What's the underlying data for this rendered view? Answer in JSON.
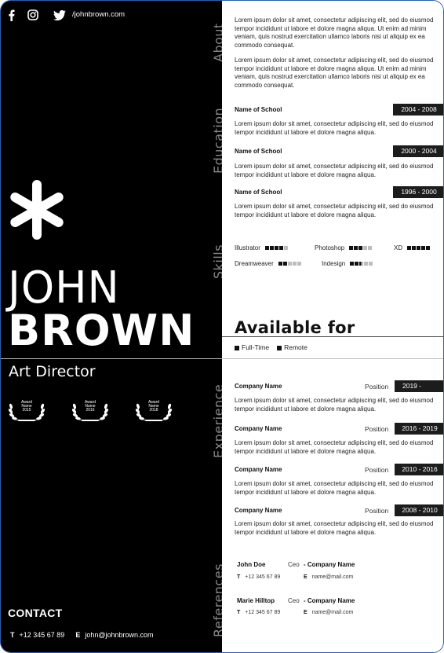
{
  "header": {
    "social_url": "/johnbrown.com",
    "icons": [
      "facebook-icon",
      "instagram-icon",
      "twitter-icon"
    ]
  },
  "profile": {
    "first_name": "JOHN",
    "last_name": "BROWN",
    "title": "Art Director",
    "awards": [
      {
        "line1": "Award",
        "line2": "Name",
        "line3": "2015"
      },
      {
        "line1": "Award",
        "line2": "Name",
        "line3": "2016"
      },
      {
        "line1": "Award",
        "line2": "Name",
        "line3": "2018"
      }
    ]
  },
  "contact": {
    "title": "CONTACT",
    "phone_label": "T",
    "phone": "+12 345 67 89",
    "email_label": "E",
    "email": "john@johnbrown.com"
  },
  "sections": {
    "about": "About",
    "education": "Education",
    "skills": "Skills",
    "experience": "Experience",
    "references": "References"
  },
  "about": {
    "paragraphs": [
      "Lorem ipsum dolor sit amet, consectetur adipiscing elit, sed do eiusmod tempor incididunt ut labore et dolore magna aliqua. Ut enim ad minim veniam, quis nostrud exercitation ullamco laboris nisi ut aliquip ex ea commodo consequat.",
      "Lorem ipsum dolor sit amet, consectetur adipiscing elit, sed do eiusmod tempor incididunt ut labore et dolore magna aliqua. Ut enim ad minim veniam, quis nostrud exercitation ullamco laboris nisi ut aliquip ex ea commodo consequat."
    ]
  },
  "education": [
    {
      "school": "Name of School",
      "dates": "2004 -  2008",
      "text": "Lorem ipsum dolor sit amet, consectetur adipiscing elit, sed do eiusmod tempor incididunt ut labore et dolore magna aliqua."
    },
    {
      "school": "Name of School",
      "dates": "2000 - 2004",
      "text": "Lorem ipsum dolor sit amet, consectetur adipiscing elit, sed do eiusmod tempor incididunt ut labore et dolore magna aliqua."
    },
    {
      "school": "Name of School",
      "dates": "1996 - 2000",
      "text": "Lorem ipsum dolor sit amet, consectetur adipiscing elit, sed do eiusmod tempor incididunt ut labore et dolore magna aliqua."
    }
  ],
  "skills": [
    {
      "name": "Illustrator",
      "level": 4,
      "max": 5
    },
    {
      "name": "Photoshop",
      "level": 3,
      "max": 5
    },
    {
      "name": "XD",
      "level": 5,
      "max": 5
    },
    {
      "name": "Dreamweaver",
      "level": 2,
      "max": 5
    },
    {
      "name": "Indesign",
      "level": 2.5,
      "max": 5
    }
  ],
  "availability": {
    "title": "Available for",
    "options": [
      "Full-Time",
      "Remote"
    ]
  },
  "experience": {
    "position_label": "Position",
    "items": [
      {
        "company": "Company Name",
        "dates": "2019 -",
        "text": "Lorem ipsum dolor sit amet, consectetur adipiscing elit, sed do eiusmod tempor incididunt ut labore et dolore magna aliqua."
      },
      {
        "company": "Company Name",
        "dates": "2016 - 2019",
        "text": "Lorem ipsum dolor sit amet, consectetur adipiscing elit, sed do eiusmod tempor incididunt ut labore et dolore magna aliqua."
      },
      {
        "company": "Company Name",
        "dates": "2010 - 2016",
        "text": "Lorem ipsum dolor sit amet, consectetur adipiscing elit, sed do eiusmod tempor incididunt ut labore et dolore magna aliqua."
      },
      {
        "company": "Company Name",
        "dates": "2008 - 2010",
        "text": "Lorem ipsum dolor sit amet, consectetur adipiscing elit, sed do eiusmod tempor incididunt ut labore et dolore magna aliqua."
      }
    ]
  },
  "references": [
    {
      "name": "John Doe",
      "role": "Ceo",
      "company": "- Company Name",
      "phone_label": "T",
      "phone": "+12 345 67 89",
      "email_label": "E",
      "email": "name@mail.com"
    },
    {
      "name": "Marie Hilltop",
      "role": "Ceo",
      "company": "- Company Name",
      "phone_label": "T",
      "phone": "+12 345 67 89",
      "email_label": "E",
      "email": "name@mail.com"
    }
  ]
}
